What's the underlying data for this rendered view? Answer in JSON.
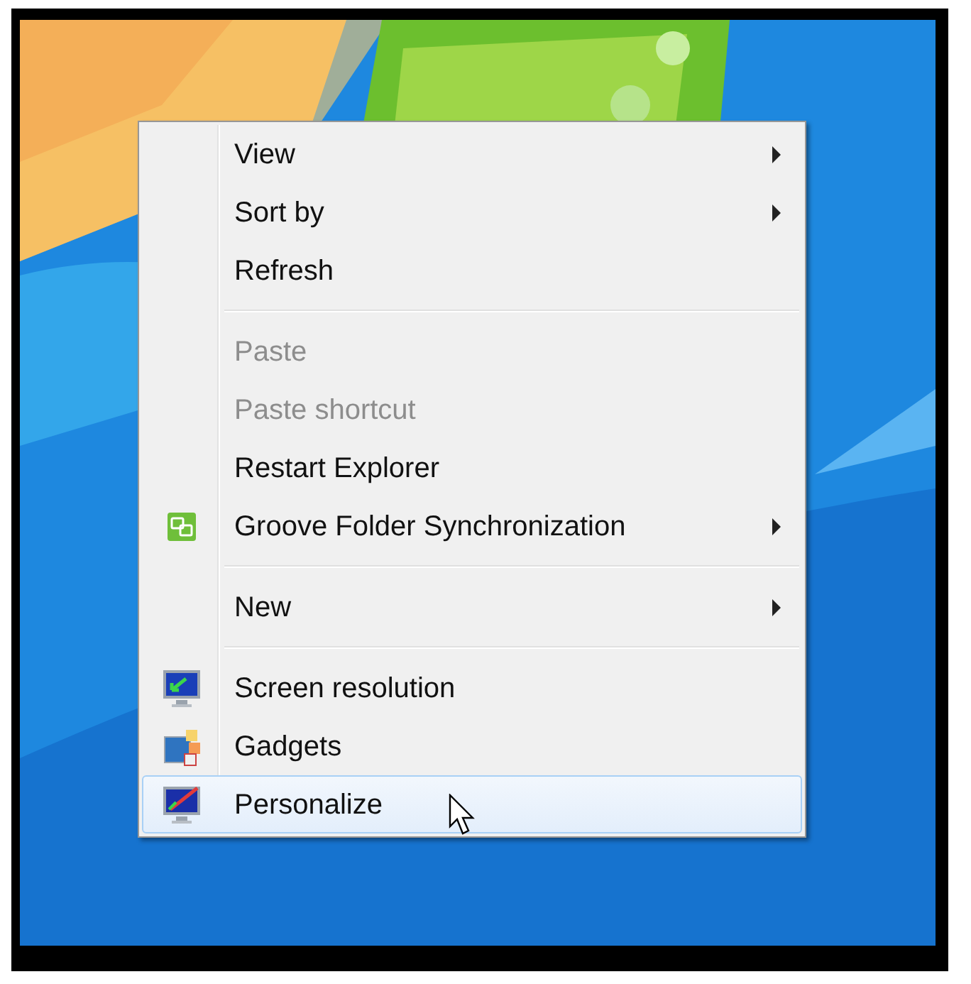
{
  "context_menu": {
    "items": [
      {
        "kind": "item",
        "label": "View",
        "disabled": false,
        "submenu": true,
        "selected": false
      },
      {
        "kind": "item",
        "label": "Sort by",
        "disabled": false,
        "submenu": true,
        "selected": false
      },
      {
        "kind": "item",
        "label": "Refresh",
        "disabled": false,
        "submenu": false,
        "selected": false
      },
      {
        "kind": "separator"
      },
      {
        "kind": "item",
        "label": "Paste",
        "disabled": true,
        "submenu": false,
        "selected": false
      },
      {
        "kind": "item",
        "label": "Paste shortcut",
        "disabled": true,
        "submenu": false,
        "selected": false
      },
      {
        "kind": "item",
        "label": "Restart Explorer",
        "disabled": false,
        "submenu": false,
        "selected": false
      },
      {
        "kind": "item",
        "label": "Groove Folder Synchronization",
        "disabled": false,
        "submenu": true,
        "selected": false
      },
      {
        "kind": "separator"
      },
      {
        "kind": "item",
        "label": "New",
        "disabled": false,
        "submenu": true,
        "selected": false
      },
      {
        "kind": "separator"
      },
      {
        "kind": "item",
        "label": "Screen resolution",
        "disabled": false,
        "submenu": false,
        "selected": false
      },
      {
        "kind": "item",
        "label": "Gadgets",
        "disabled": false,
        "submenu": false,
        "selected": false
      },
      {
        "kind": "item",
        "label": "Personalize",
        "disabled": false,
        "submenu": false,
        "selected": true
      }
    ]
  }
}
